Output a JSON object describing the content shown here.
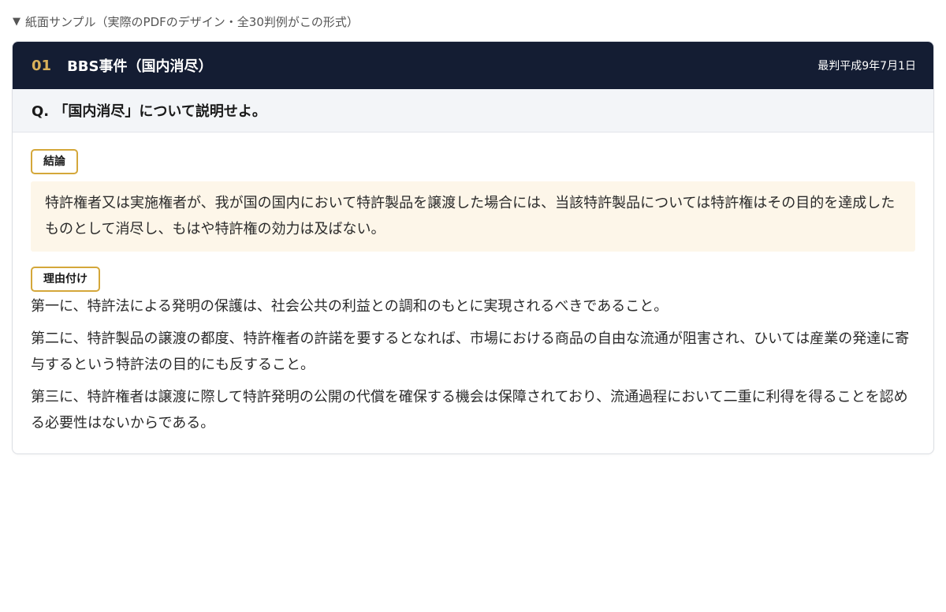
{
  "sample_toggle": {
    "icon": "triangle-down-icon",
    "label": "紙面サンプル（実際のPDFのデザイン・全30判例がこの形式）"
  },
  "card": {
    "number": "01",
    "title": "BBS事件（国内消尽）",
    "date": "最判平成9年7月1日",
    "question": "Q. 「国内消尽」について説明せよ。",
    "conclusion_label": "結論",
    "conclusion_text": "特許権者又は実施権者が、我が国の国内において特許製品を譲渡した場合には、当該特許製品については特許権はその目的を達成したものとして消尽し、もはや特許権の効力は及ばない。",
    "reasons_label": "理由付け",
    "reasons": [
      "第一に、特許法による発明の保護は、社会公共の利益との調和のもとに実現されるべきであること。",
      "第二に、特許製品の譲渡の都度、特許権者の許諾を要するとなれば、市場における商品の自由な流通が阻害され、ひいては産業の発達に寄与するという特許法の目的にも反すること。",
      "第三に、特許権者は譲渡に際して特許発明の公開の代償を確保する機会は保障されており、流通過程において二重に利得を得ることを認める必要性はないからである。"
    ]
  },
  "colors": {
    "header_bg": "#141d33",
    "accent_gold": "#d9b15a",
    "tag_border": "#d4a73a",
    "conclusion_bg": "#fdf6e9",
    "question_bg": "#f3f5f8"
  }
}
